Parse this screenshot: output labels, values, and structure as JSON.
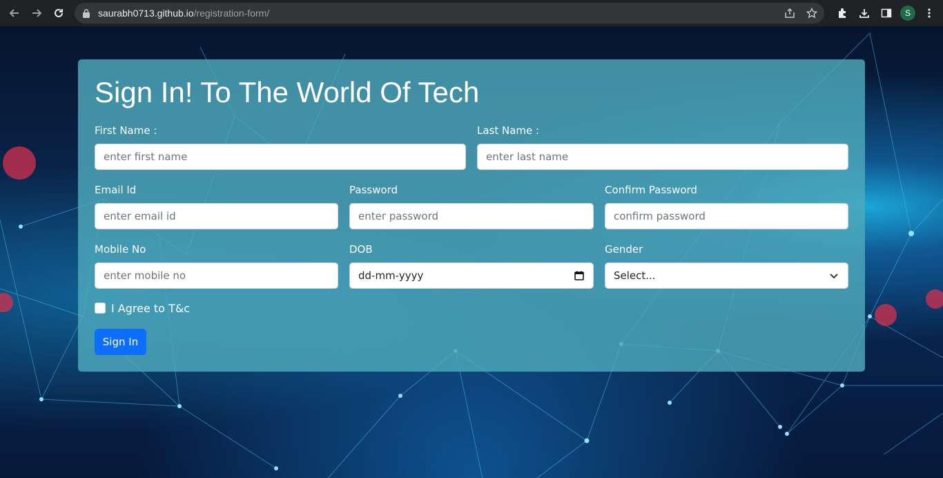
{
  "browser": {
    "url_host": "saurabh0713.github.io",
    "url_path": "/registration-form/",
    "profile_initial": "S"
  },
  "form": {
    "title": "Sign In! To The World Of Tech",
    "fields": {
      "first_name": {
        "label": "First Name :",
        "placeholder": "enter first name"
      },
      "last_name": {
        "label": "Last Name :",
        "placeholder": "enter last name"
      },
      "email": {
        "label": "Email Id",
        "placeholder": "enter email id"
      },
      "password": {
        "label": "Password",
        "placeholder": "enter password"
      },
      "confirm_password": {
        "label": "Confirm Password",
        "placeholder": "confirm password"
      },
      "mobile": {
        "label": "Mobile No",
        "placeholder": "enter mobile no"
      },
      "dob": {
        "label": "DOB",
        "value": "dd-mm-yyyy"
      },
      "gender": {
        "label": "Gender",
        "selected": "Select..."
      }
    },
    "agree_label": "I Agree to T&c",
    "submit_label": "Sign In"
  },
  "colors": {
    "accent": "#0d6efd",
    "card": "#4eaabc",
    "chrome": "#202124"
  }
}
